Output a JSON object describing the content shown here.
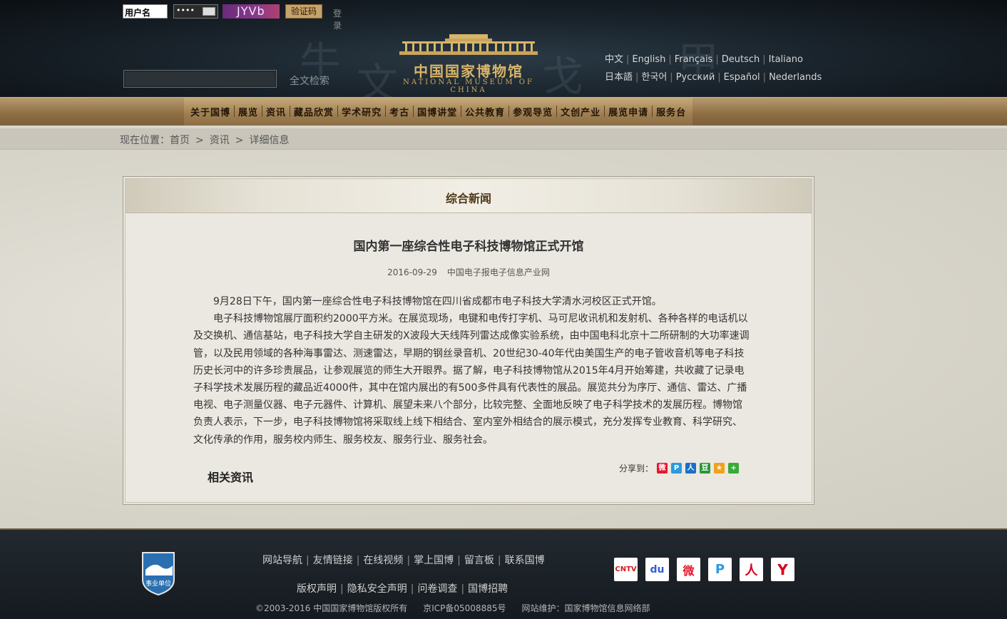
{
  "login": {
    "username_value": "用户名",
    "password_value": "••••",
    "captcha_text": "JYVb",
    "captcha_button": "验证码",
    "login_button": "登录"
  },
  "search": {
    "value": "",
    "button_label": "全文检索"
  },
  "logo": {
    "name_cn": "中国国家博物馆",
    "name_en": "NATIONAL MUSEUM OF CHINA"
  },
  "languages": {
    "row1": [
      "中文",
      "English",
      "Français",
      "Deutsch",
      "Italiano"
    ],
    "row2": [
      "日本語",
      "한국어",
      "Русский",
      "Español",
      "Nederlands"
    ]
  },
  "nav": [
    "关于国博",
    "展览",
    "资讯",
    "藏品欣赏",
    "学术研究",
    "考古",
    "国博讲堂",
    "公共教育",
    "参观导览",
    "文创产业",
    "展览申请",
    "服务台"
  ],
  "breadcrumb": {
    "label": "现在位置：",
    "items": [
      "首页",
      "资讯",
      "详细信息"
    ],
    "separator": ">"
  },
  "panel": {
    "title": "综合新闻"
  },
  "article": {
    "title": "国内第一座综合性电子科技博物馆正式开馆",
    "date": "2016-09-29",
    "source": "中国电子报电子信息产业网",
    "paragraphs": [
      "9月28日下午，国内第一座综合性电子科技博物馆在四川省成都市电子科技大学清水河校区正式开馆。",
      "电子科技博物馆展厅面积约2000平方米。在展览现场，电键和电传打字机、马可尼收讯机和发射机、各种各样的电话机以及交换机、通信基站，电子科技大学自主研发的X波段大天线阵列雷达成像实验系统，由中国电科北京十二所研制的大功率速调管，以及民用领域的各种海事雷达、测速雷达，早期的钢丝录音机、20世纪30-40年代由美国生产的电子管收音机等电子科技历史长河中的许多珍贵展品，让参观展览的师生大开眼界。据了解，电子科技博物馆从2015年4月开始筹建，共收藏了记录电子科学技术发展历程的藏品近4000件，其中在馆内展出的有500多件具有代表性的展品。展览共分为序厅、通信、雷达、广播电视、电子测量仪器、电子元器件、计算机、展望未来八个部分，比较完整、全面地反映了电子科学技术的发展历程。博物馆负责人表示，下一步，电子科技博物馆将采取线上线下相结合、室内室外相结合的展示模式，充分发挥专业教育、科学研究、文化传承的作用，服务校内师生、服务校友、服务行业、服务社会。"
    ],
    "share_label": "分享到：",
    "share_icons": [
      {
        "icon": "weibo-icon",
        "color": "#e6162d",
        "glyph": "微"
      },
      {
        "icon": "tencent-weibo-icon",
        "color": "#2b9ae0",
        "glyph": "P"
      },
      {
        "icon": "renren-icon",
        "color": "#1a6fc4",
        "glyph": "人"
      },
      {
        "icon": "douban-icon",
        "color": "#2e963d",
        "glyph": "豆"
      },
      {
        "icon": "qzone-icon",
        "color": "#f0a21a",
        "glyph": "★"
      },
      {
        "icon": "more-share-icon",
        "color": "#3aa93a",
        "glyph": "+"
      }
    ],
    "related_label": "相关资讯"
  },
  "footer": {
    "badge_text": "事业单位",
    "links_row1": [
      "网站导航",
      "友情链接",
      "在线视频",
      "掌上国博",
      "留言板",
      "联系国博"
    ],
    "links_row2": [
      "版权声明",
      "隐私安全声明",
      "问卷调查",
      "国博招聘"
    ],
    "copyright": "©2003-2016 中国国家博物馆版权所有",
    "icp": "京ICP备05008885号",
    "maintainer": "网站维护：国家博物馆信息网络部",
    "social": [
      {
        "icon": "cntv-icon",
        "label": "CNTV",
        "color": "#d11a1a"
      },
      {
        "icon": "baidu-icon",
        "label": "du",
        "color": "#2f5fd1"
      },
      {
        "icon": "sina-weibo-icon",
        "label": "微",
        "color": "#e6162d"
      },
      {
        "icon": "tencent-weibo-icon",
        "label": "P",
        "color": "#2b9ae0"
      },
      {
        "icon": "renren-icon",
        "label": "人",
        "color": "#d8001c"
      },
      {
        "icon": "yixin-icon",
        "label": "Y",
        "color": "#d8001c"
      }
    ]
  }
}
